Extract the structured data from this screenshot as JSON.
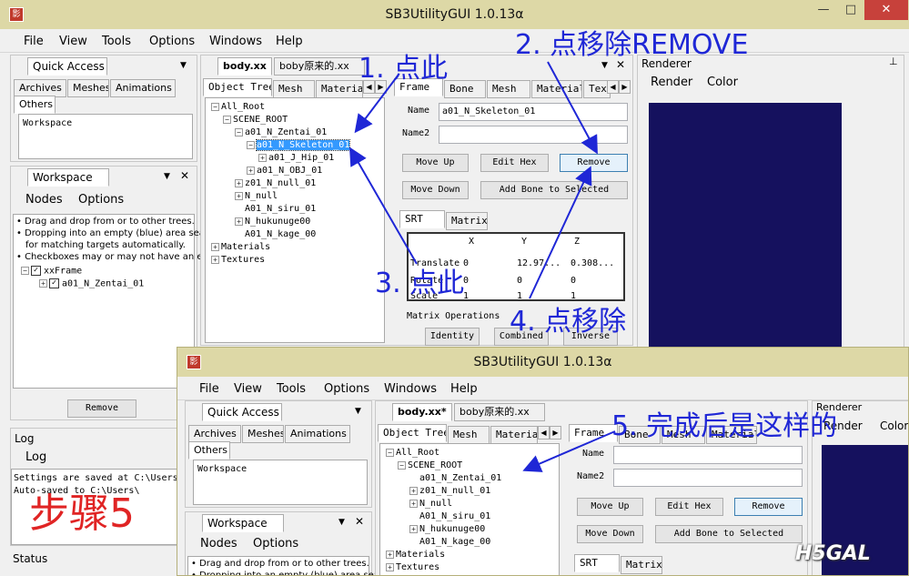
{
  "app": {
    "title": "SB3UtilityGUI 1.0.13α",
    "icon_text": "影"
  },
  "window_buttons": {
    "minimize": "—",
    "maximize": "□",
    "close": "✕"
  },
  "menu": [
    "File",
    "View",
    "Tools",
    "Options",
    "Windows",
    "Help"
  ],
  "quick_access": {
    "title": "Quick Access",
    "tabs": [
      "Archives",
      "Meshes",
      "Animations",
      "Others"
    ],
    "item": "Workspace"
  },
  "workspace": {
    "title": "Workspace",
    "menu": [
      "Nodes",
      "Options"
    ],
    "notes": [
      "• Drag and drop from or to other trees.",
      "• Dropping into an empty (blue) area searc",
      "for matching targets automatically.",
      "• Checkboxes may or may not have an eff"
    ],
    "tree": {
      "root": "xxFrame",
      "child": "a01_N_Zentai_01"
    },
    "remove_button": "Remove"
  },
  "log": {
    "title": "Log",
    "tab": "Log",
    "lines": [
      "Settings are saved at C:\\Users",
      "Auto-saved to C:\\Users\\"
    ]
  },
  "status": "Status",
  "editor": {
    "tabs": [
      "body.xx",
      "boby原来的.xx"
    ],
    "tabs_after": [
      "body.xx*",
      "boby原来的.xx"
    ],
    "left_tabs": [
      "Object Tree",
      "Mesh",
      "Materia"
    ],
    "tree": [
      {
        "label": "All_Root",
        "level": 0
      },
      {
        "label": "SCENE_ROOT",
        "level": 1
      },
      {
        "label": "a01_N_Zentai_01",
        "level": 2
      },
      {
        "label": "a01_N_Skeleton_01",
        "level": 3
      },
      {
        "label": "a01_J_Hip_01",
        "level": 4
      },
      {
        "label": "a01_N_OBJ_01",
        "level": 3
      },
      {
        "label": "z01_N_null_01",
        "level": 2
      },
      {
        "label": "N_null",
        "level": 2
      },
      {
        "label": "A01_N_siru_01",
        "level": 2
      },
      {
        "label": "N_hukunuge00",
        "level": 2
      },
      {
        "label": "A01_N_kage_00",
        "level": 2
      },
      {
        "label": "Materials",
        "level": 0
      },
      {
        "label": "Textures",
        "level": 0
      }
    ],
    "tree_after": [
      {
        "label": "All_Root",
        "level": 0
      },
      {
        "label": "SCENE_ROOT",
        "level": 1
      },
      {
        "label": "a01_N_Zentai_01",
        "level": 2
      },
      {
        "label": "z01_N_null_01",
        "level": 2
      },
      {
        "label": "N_null",
        "level": 2
      },
      {
        "label": "A01_N_siru_01",
        "level": 2
      },
      {
        "label": "N_hukunuge00",
        "level": 2
      },
      {
        "label": "A01_N_kage_00",
        "level": 2
      },
      {
        "label": "Materials",
        "level": 0
      },
      {
        "label": "Textures",
        "level": 0
      }
    ],
    "right_tabs": [
      "Frame",
      "Bone",
      "Mesh",
      "Material",
      "Tex"
    ],
    "name_label": "Name",
    "name2_label": "Name2",
    "name_value": "a01_N_Skeleton_01",
    "buttons": {
      "move_up": "Move Up",
      "edit_hex": "Edit Hex",
      "remove": "Remove",
      "move_down": "Move Down",
      "add_bone": "Add Bone to Selected"
    },
    "srt_tabs": [
      "SRT",
      "Matrix"
    ],
    "grid_headers": [
      "X",
      "Y",
      "Z"
    ],
    "grid_rows": [
      {
        "label": "Translate",
        "x": "0",
        "y": "12.97...",
        "z": "0.308..."
      },
      {
        "label": "Rotate",
        "x": "0",
        "y": "0",
        "z": "0"
      },
      {
        "label": "Scale",
        "x": "1",
        "y": "1",
        "z": "1"
      }
    ],
    "matrix_ops": {
      "title": "Matrix Operations",
      "identity": "Identity",
      "combined": "Combined",
      "inverse": "Inverse"
    }
  },
  "renderer": {
    "title": "Renderer",
    "menu": [
      "Render",
      "Color"
    ],
    "viewport_color": "#15115e"
  },
  "annotations": {
    "step1": "1. 点此",
    "step2": "2. 点移除REMOVE",
    "step3": "3. 点此",
    "step4": "4. 点移除",
    "step5": "5. 完成后是这样的",
    "step_red": "步骤5"
  },
  "watermark": "H5GAL",
  "colors": {
    "annotation_blue": "#1f27d6",
    "annotation_red": "#e02424",
    "titlebar": "#ddd8a6",
    "selection": "#3399ff"
  }
}
